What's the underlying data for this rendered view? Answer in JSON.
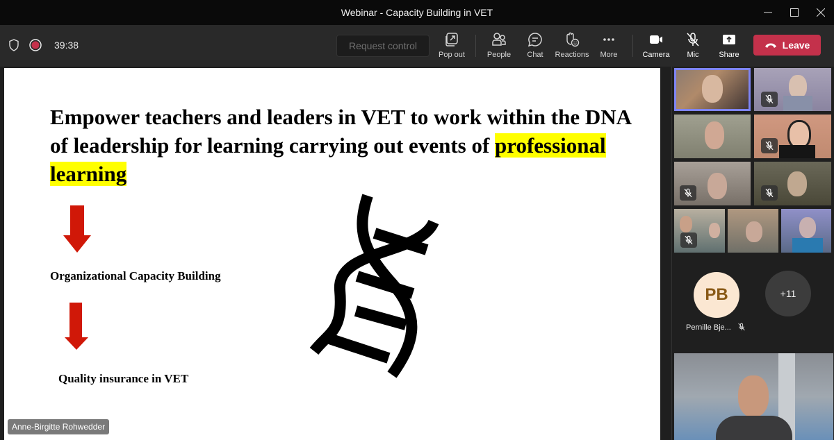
{
  "window": {
    "title": "Webinar - Capacity Building in VET",
    "controls": [
      "minimize-icon",
      "maximize-icon",
      "close-icon"
    ]
  },
  "toolbar": {
    "timer": "39:38",
    "request_control": "Request control",
    "buttons": [
      {
        "label": "Pop out",
        "icon": "pop-out-icon"
      },
      {
        "label": "People",
        "icon": "people-icon"
      },
      {
        "label": "Chat",
        "icon": "chat-icon"
      },
      {
        "label": "Reactions",
        "icon": "reactions-icon"
      },
      {
        "label": "More",
        "icon": "more-icon"
      },
      {
        "label": "Camera",
        "icon": "camera-icon"
      },
      {
        "label": "Mic",
        "icon": "mic-off-icon"
      },
      {
        "label": "Share",
        "icon": "share-icon"
      }
    ],
    "leave": "Leave",
    "colors": {
      "leave": "#c4314b",
      "record": "#c4314b"
    }
  },
  "slide": {
    "headline_part1": "Empower teachers and leaders in VET to work within the DNA of leadership for learning carrying out events of",
    "headline_highlight": "professional learning",
    "items": [
      "Organizational Capacity Building",
      "Quality insurance in VET"
    ],
    "colors": {
      "arrow": "#d01808",
      "highlight": "#ffff00"
    }
  },
  "presenter": {
    "name": "Anne-Birgitte Rohwedder"
  },
  "roster": {
    "participants": [
      {
        "name": "Pernille Bje...",
        "initials": "PB",
        "muted": true
      }
    ],
    "overflow": "+11"
  }
}
